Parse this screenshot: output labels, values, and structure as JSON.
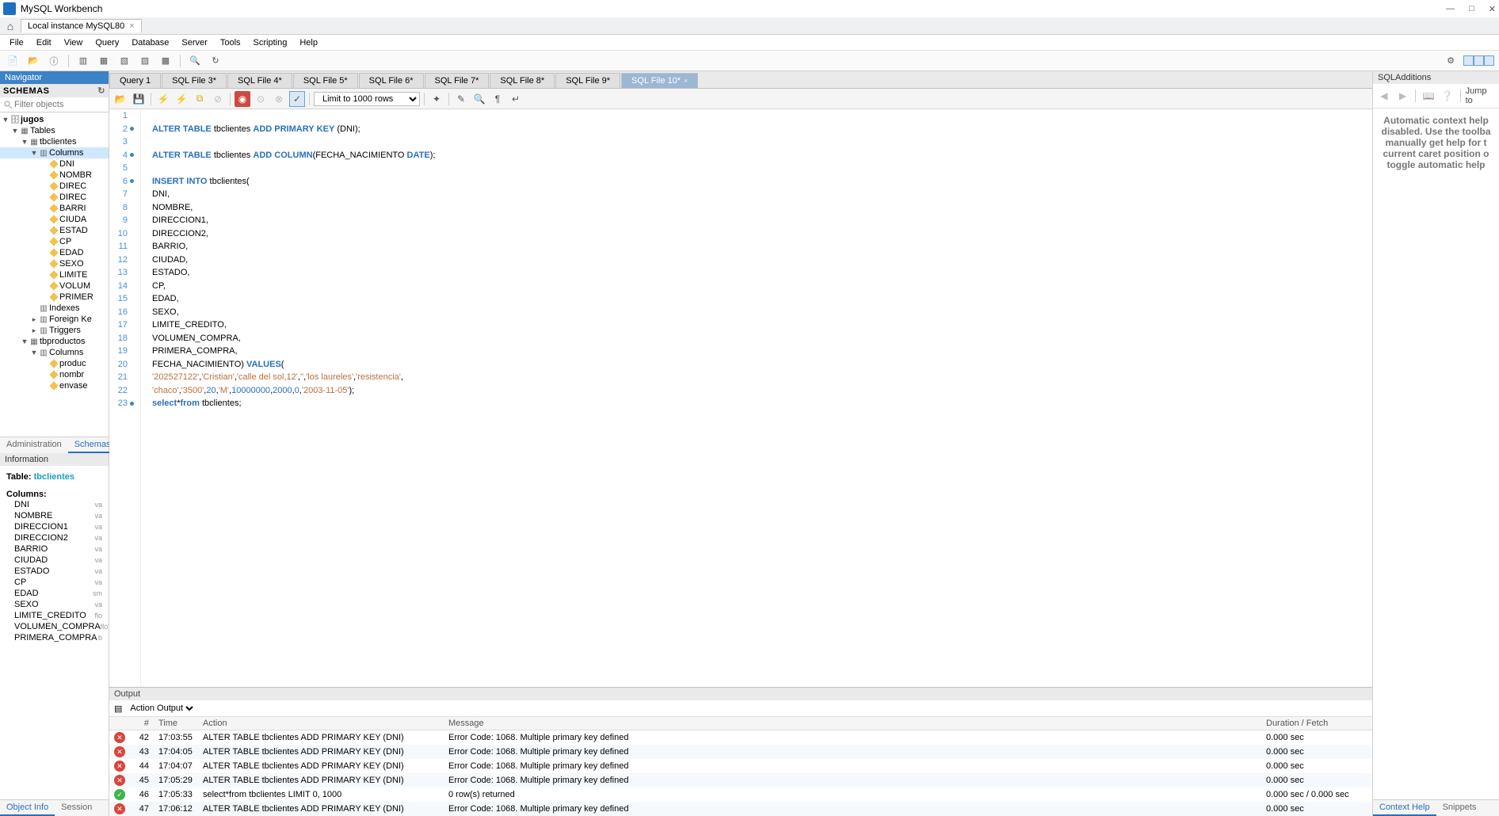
{
  "window": {
    "title": "MySQL Workbench"
  },
  "connection_tab": "Local instance MySQL80",
  "menu": [
    "File",
    "Edit",
    "View",
    "Query",
    "Database",
    "Server",
    "Tools",
    "Scripting",
    "Help"
  ],
  "navigator": {
    "title": "Navigator"
  },
  "schemas": {
    "header": "SCHEMAS",
    "filter_placeholder": "Filter objects",
    "tree": {
      "db": "jugos",
      "tables_label": "Tables",
      "table1": "tbclientes",
      "columns_label": "Columns",
      "cols1": [
        "DNI",
        "NOMBR",
        "DIREC",
        "DIREC",
        "BARRI",
        "CIUDA",
        "ESTAD",
        "CP",
        "EDAD",
        "SEXO",
        "LIMITE",
        "VOLUM",
        "PRIMER"
      ],
      "indexes": "Indexes",
      "foreign_keys": "Foreign Ke",
      "triggers": "Triggers",
      "table2": "tbproductos",
      "cols2": [
        "produc",
        "nombr",
        "envase"
      ]
    },
    "tabs": {
      "admin": "Administration",
      "schemas": "Schemas"
    }
  },
  "information": {
    "header": "Information",
    "table_label": "Table:",
    "table_name": "tbclientes",
    "columns_label": "Columns:",
    "columns": [
      {
        "n": "DNI",
        "t": "va"
      },
      {
        "n": "NOMBRE",
        "t": "va"
      },
      {
        "n": "DIRECCION1",
        "t": "va"
      },
      {
        "n": "DIRECCION2",
        "t": "va"
      },
      {
        "n": "BARRIO",
        "t": "va"
      },
      {
        "n": "CIUDAD",
        "t": "va"
      },
      {
        "n": "ESTADO",
        "t": "va"
      },
      {
        "n": "CP",
        "t": "va"
      },
      {
        "n": "EDAD",
        "t": "sm"
      },
      {
        "n": "SEXO",
        "t": "va"
      },
      {
        "n": "LIMITE_CREDITO",
        "t": "flo"
      },
      {
        "n": "VOLUMEN_COMPRA",
        "t": "flo"
      },
      {
        "n": "PRIMERA_COMPRA",
        "t": "b"
      }
    ],
    "bottom_tabs": {
      "object_info": "Object Info",
      "session": "Session"
    }
  },
  "query_tabs": [
    {
      "label": "Query 1",
      "active": false
    },
    {
      "label": "SQL File 3*",
      "active": false
    },
    {
      "label": "SQL File 4*",
      "active": false
    },
    {
      "label": "SQL File 5*",
      "active": false
    },
    {
      "label": "SQL File 6*",
      "active": false
    },
    {
      "label": "SQL File 7*",
      "active": false
    },
    {
      "label": "SQL File 8*",
      "active": false
    },
    {
      "label": "SQL File 9*",
      "active": false
    },
    {
      "label": "SQL File 10*",
      "active": true
    }
  ],
  "limit_label": "Limit to 1000 rows",
  "code_lines": [
    {
      "n": 1,
      "dot": false,
      "html": ""
    },
    {
      "n": 2,
      "dot": true,
      "html": "<span class='kw'>ALTER</span> <span class='kw'>TABLE</span> tbclientes <span class='kw'>ADD</span> <span class='kw'>PRIMARY</span> <span class='kw'>KEY</span> (DNI);"
    },
    {
      "n": 3,
      "dot": false,
      "html": ""
    },
    {
      "n": 4,
      "dot": true,
      "html": "<span class='kw'>ALTER</span> <span class='kw'>TABLE</span> tbclientes <span class='kw'>ADD</span> <span class='kw'>COLUMN</span>(FECHA_NACIMIENTO <span class='kw'>DATE</span>);"
    },
    {
      "n": 5,
      "dot": false,
      "html": ""
    },
    {
      "n": 6,
      "dot": true,
      "html": "<span class='kw'>INSERT</span> <span class='kw'>INTO</span> tbclientes("
    },
    {
      "n": 7,
      "dot": false,
      "html": "DNI,"
    },
    {
      "n": 8,
      "dot": false,
      "html": "NOMBRE,"
    },
    {
      "n": 9,
      "dot": false,
      "html": "DIRECCION1,"
    },
    {
      "n": 10,
      "dot": false,
      "html": "DIRECCION2,"
    },
    {
      "n": 11,
      "dot": false,
      "html": "BARRIO,"
    },
    {
      "n": 12,
      "dot": false,
      "html": "CIUDAD,"
    },
    {
      "n": 13,
      "dot": false,
      "html": "ESTADO,"
    },
    {
      "n": 14,
      "dot": false,
      "html": "CP,"
    },
    {
      "n": 15,
      "dot": false,
      "html": "EDAD,"
    },
    {
      "n": 16,
      "dot": false,
      "html": "SEXO,"
    },
    {
      "n": 17,
      "dot": false,
      "html": "LIMITE_CREDITO,"
    },
    {
      "n": 18,
      "dot": false,
      "html": "VOLUMEN_COMPRA,"
    },
    {
      "n": 19,
      "dot": false,
      "html": "PRIMERA_COMPRA,"
    },
    {
      "n": 20,
      "dot": false,
      "html": "FECHA_NACIMIENTO) <span class='kw'>VALUES</span>("
    },
    {
      "n": 21,
      "dot": false,
      "html": "<span class='str'>'202527122'</span>,<span class='str'>'Cristian'</span>,<span class='str'>'calle del sol,12'</span>,<span class='str'>''</span>,<span class='str'>'los laureles'</span>,<span class='str'>'resistencia'</span>,"
    },
    {
      "n": 22,
      "dot": false,
      "html": "<span class='str'>'chaco'</span>,<span class='str'>'3500'</span>,<span class='num'>20</span>,<span class='str'>'M'</span>,<span class='num'>10000000</span>,<span class='num'>2000</span>,<span class='num'>0</span>,<span class='str'>'2003-11-05'</span>);"
    },
    {
      "n": 23,
      "dot": true,
      "html": "<span class='kw'>select</span>*<span class='kw'>from</span> tbclientes;"
    }
  ],
  "output": {
    "header": "Output",
    "type": "Action Output",
    "cols": {
      "num": "#",
      "time": "Time",
      "action": "Action",
      "msg": "Message",
      "dur": "Duration / Fetch"
    },
    "rows": [
      {
        "status": "err",
        "n": "42",
        "time": "17:03:55",
        "action": "ALTER TABLE tbclientes ADD PRIMARY KEY (DNI)",
        "msg": "Error Code: 1068. Multiple primary key defined",
        "dur": "0.000 sec"
      },
      {
        "status": "err",
        "n": "43",
        "time": "17:04:05",
        "action": "ALTER TABLE tbclientes ADD PRIMARY KEY (DNI)",
        "msg": "Error Code: 1068. Multiple primary key defined",
        "dur": "0.000 sec"
      },
      {
        "status": "err",
        "n": "44",
        "time": "17:04:07",
        "action": "ALTER TABLE tbclientes ADD PRIMARY KEY (DNI)",
        "msg": "Error Code: 1068. Multiple primary key defined",
        "dur": "0.000 sec"
      },
      {
        "status": "err",
        "n": "45",
        "time": "17:05:29",
        "action": "ALTER TABLE tbclientes ADD PRIMARY KEY (DNI)",
        "msg": "Error Code: 1068. Multiple primary key defined",
        "dur": "0.000 sec"
      },
      {
        "status": "ok",
        "n": "46",
        "time": "17:05:33",
        "action": "select*from tbclientes LIMIT 0, 1000",
        "msg": "0 row(s) returned",
        "dur": "0.000 sec / 0.000 sec"
      },
      {
        "status": "err",
        "n": "47",
        "time": "17:06:12",
        "action": "ALTER TABLE tbclientes ADD PRIMARY KEY (DNI)",
        "msg": "Error Code: 1068. Multiple primary key defined",
        "dur": "0.000 sec"
      }
    ]
  },
  "sql_additions": {
    "header": "SQLAdditions",
    "jump_label": "Jump to",
    "body": "Automatic context help disabled. Use the toolba manually get help for t current caret position o toggle automatic help",
    "tabs": {
      "context": "Context Help",
      "snippets": "Snippets"
    }
  }
}
